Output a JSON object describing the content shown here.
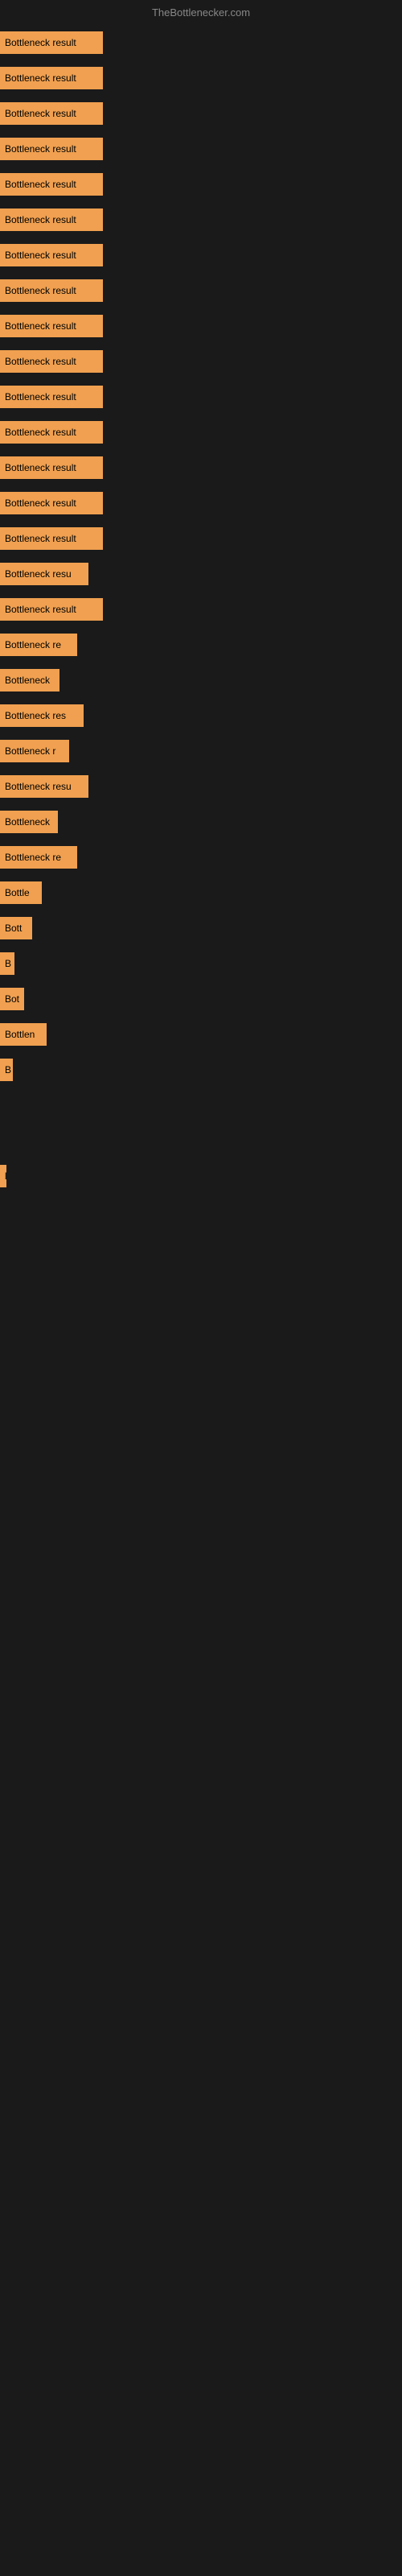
{
  "header": {
    "title": "TheBottlenecker.com"
  },
  "bars": [
    {
      "label": "Bottleneck result",
      "width": 128
    },
    {
      "label": "Bottleneck result",
      "width": 128
    },
    {
      "label": "Bottleneck result",
      "width": 128
    },
    {
      "label": "Bottleneck result",
      "width": 128
    },
    {
      "label": "Bottleneck result",
      "width": 128
    },
    {
      "label": "Bottleneck result",
      "width": 128
    },
    {
      "label": "Bottleneck result",
      "width": 128
    },
    {
      "label": "Bottleneck result",
      "width": 128
    },
    {
      "label": "Bottleneck result",
      "width": 128
    },
    {
      "label": "Bottleneck result",
      "width": 128
    },
    {
      "label": "Bottleneck result",
      "width": 128
    },
    {
      "label": "Bottleneck result",
      "width": 128
    },
    {
      "label": "Bottleneck result",
      "width": 128
    },
    {
      "label": "Bottleneck result",
      "width": 128
    },
    {
      "label": "Bottleneck result",
      "width": 128
    },
    {
      "label": "Bottleneck resu",
      "width": 110
    },
    {
      "label": "Bottleneck result",
      "width": 128
    },
    {
      "label": "Bottleneck re",
      "width": 96
    },
    {
      "label": "Bottleneck",
      "width": 74
    },
    {
      "label": "Bottleneck res",
      "width": 104
    },
    {
      "label": "Bottleneck r",
      "width": 86
    },
    {
      "label": "Bottleneck resu",
      "width": 110
    },
    {
      "label": "Bottleneck",
      "width": 72
    },
    {
      "label": "Bottleneck re",
      "width": 96
    },
    {
      "label": "Bottle",
      "width": 52
    },
    {
      "label": "Bott",
      "width": 40
    },
    {
      "label": "B",
      "width": 18
    },
    {
      "label": "Bot",
      "width": 30
    },
    {
      "label": "Bottlen",
      "width": 58
    },
    {
      "label": "B",
      "width": 16
    },
    {
      "label": "",
      "width": 0
    },
    {
      "label": "",
      "width": 0
    },
    {
      "label": "l",
      "width": 8
    },
    {
      "label": "",
      "width": 0
    },
    {
      "label": "",
      "width": 0
    }
  ]
}
